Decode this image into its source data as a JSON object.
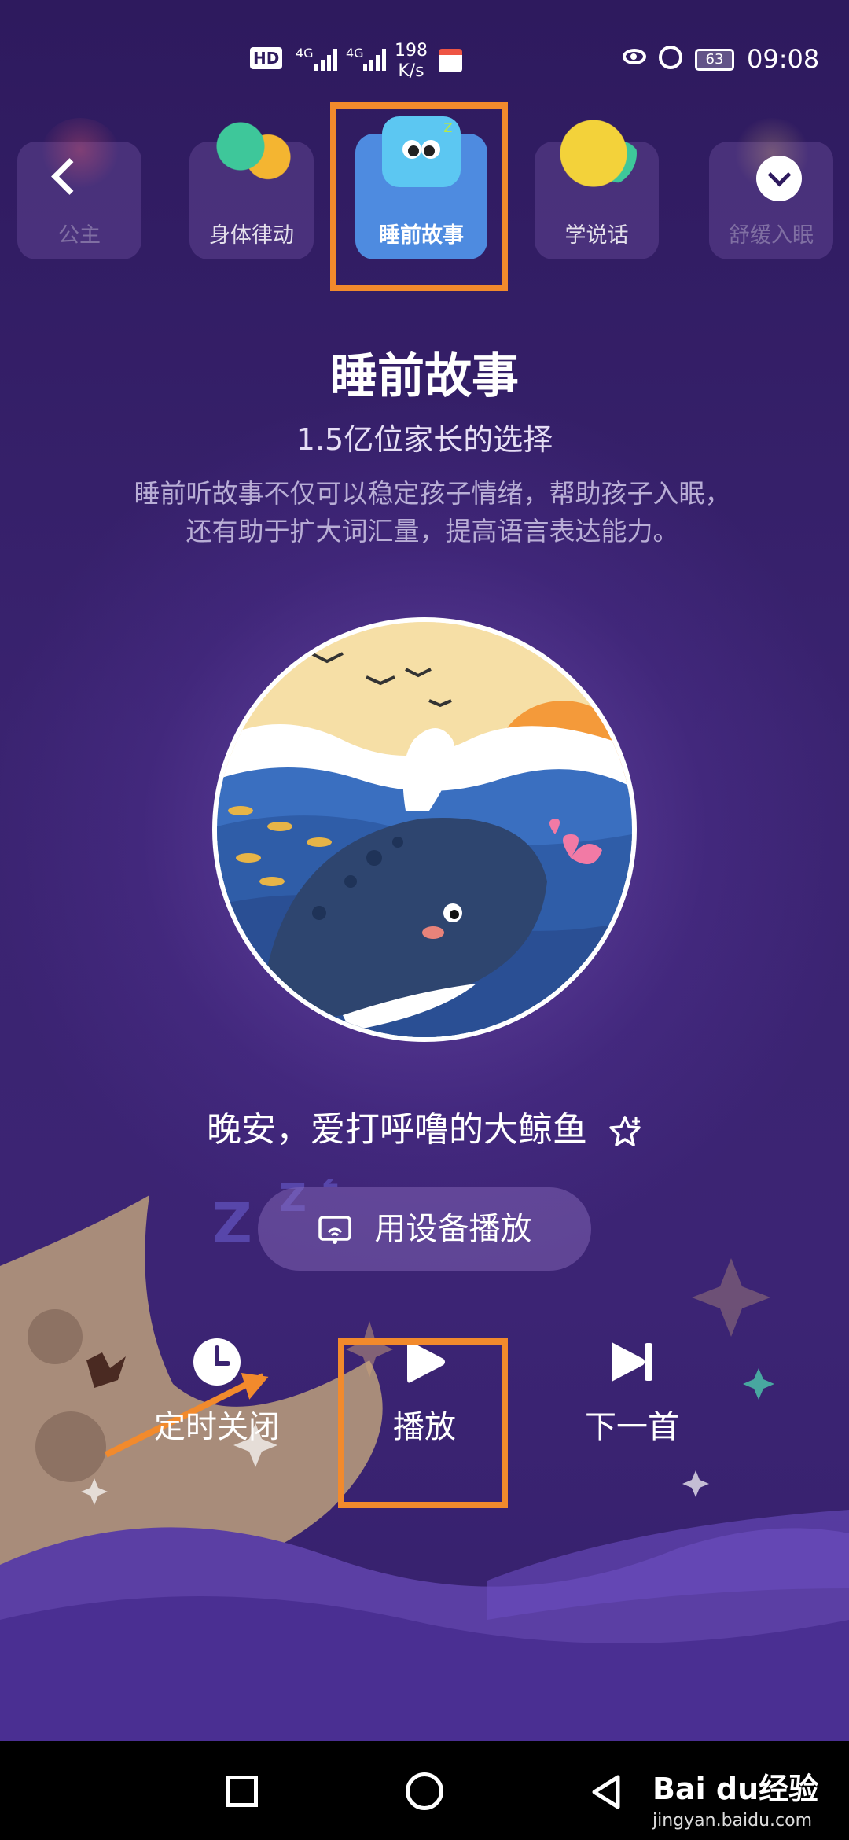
{
  "status_bar": {
    "hd": "HD",
    "sim1": "4G",
    "sim2": "4G",
    "speed_value": "198",
    "speed_unit": "K/s",
    "battery": "63",
    "time": "09:08"
  },
  "categories": [
    {
      "label": "公主"
    },
    {
      "label": "身体律动"
    },
    {
      "label": "睡前故事",
      "active": true
    },
    {
      "label": "学说话"
    },
    {
      "label": "舒缓入眠"
    }
  ],
  "header": {
    "title": "睡前故事",
    "subtitle": "1.5亿位家长的选择",
    "description": "睡前听故事不仅可以稳定孩子情绪，帮助孩子入眠，还有助于扩大词汇量，提高语言表达能力。"
  },
  "player": {
    "story_title": "晚安，爱打呼噜的大鲸鱼",
    "device_button": "用设备播放",
    "controls": {
      "timer": "定时关闭",
      "play": "播放",
      "next": "下一首"
    }
  },
  "watermark": {
    "brand": "Bai du经验",
    "site": "jingyan.baidu.com"
  },
  "colors": {
    "background": "#3a2370",
    "highlight": "#f28a2c",
    "active_tab": "#4e8be0"
  }
}
